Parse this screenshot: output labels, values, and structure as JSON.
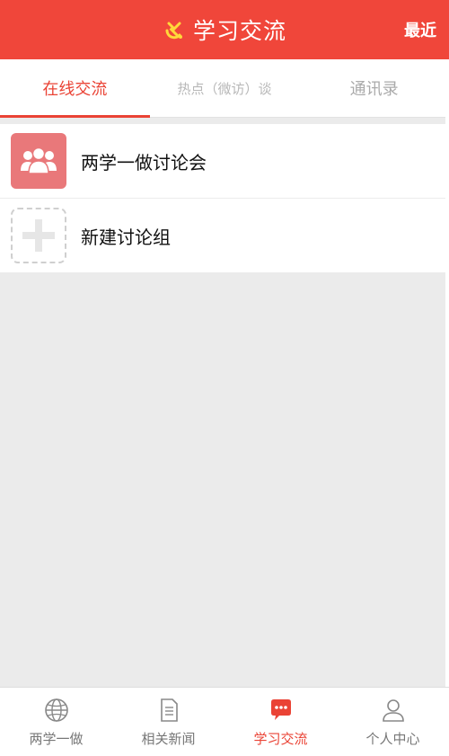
{
  "header": {
    "title": "学习交流",
    "recent_label": "最近",
    "emblem_icon": "hammer-sickle-icon",
    "emblem_color": "#ffd83a",
    "background": "#f0463a"
  },
  "tabs": [
    {
      "label": "在线交流",
      "active": true
    },
    {
      "label": "热点（微访）谈",
      "active": false
    },
    {
      "label": "通讯录",
      "active": false
    }
  ],
  "list": [
    {
      "label": "两学一做讨论会",
      "icon": "group-icon"
    },
    {
      "label": "新建讨论组",
      "icon": "add-icon"
    }
  ],
  "bottom_nav": [
    {
      "label": "两学一做",
      "icon": "globe-icon",
      "active": false
    },
    {
      "label": "相关新闻",
      "icon": "document-icon",
      "active": false
    },
    {
      "label": "学习交流",
      "icon": "chat-bubble-icon",
      "active": true
    },
    {
      "label": "个人中心",
      "icon": "person-icon",
      "active": false
    }
  ],
  "accent_color": "#ea4335"
}
